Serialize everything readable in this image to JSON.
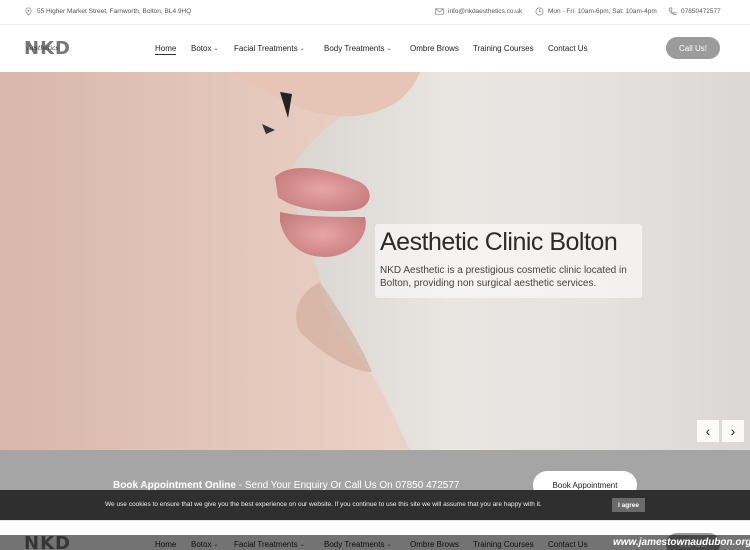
{
  "topbar": {
    "address": "55 Higher Market Street, Farnworth, Bolton, BL4 9HQ",
    "email": "info@nkdaesthetics.co.uk",
    "hours": "Mon - Fri: 10am-6pm, Sat: 10am-4pm",
    "phone": "07850472577"
  },
  "logo": {
    "text": "NKD",
    "script": "Aesthetics"
  },
  "nav": [
    {
      "label": "Home",
      "active": true
    },
    {
      "label": "Botox",
      "dropdown": true
    },
    {
      "label": "Facial Treatments",
      "dropdown": true
    },
    {
      "label": "Body Treatments",
      "dropdown": true
    },
    {
      "label": "Ombre Brows"
    },
    {
      "label": "Training Courses"
    },
    {
      "label": "Contact Us"
    }
  ],
  "call_button": "Call Us!",
  "hero": {
    "title": "Aesthetic Clinic Bolton",
    "text": "NKD Aesthetic is a prestigious cosmetic clinic located in Bolton, providing non surgical aesthetic services.",
    "prev": "‹",
    "next": "›"
  },
  "booking": {
    "bold": "Book Appointment Online",
    "rest": " - Send Your Enquiry Or Call Us On 07850 472577",
    "button": "Book Appointment"
  },
  "cookie": {
    "text": "We use cookies to ensure that we give you the best experience on our website. If you continue to use this site we will assume that you are happy with it.",
    "button": "I agree"
  },
  "watermark": "www.jamestownaudubon.org",
  "icons": {
    "address": "map-pin-icon",
    "email": "envelope-icon",
    "hours": "clock-icon",
    "phone": "phone-icon"
  },
  "colors": {
    "call_button": "#9b9b9b",
    "booking_bg": "#a5a5a5",
    "cookie_bg": "#2f2f2f"
  }
}
